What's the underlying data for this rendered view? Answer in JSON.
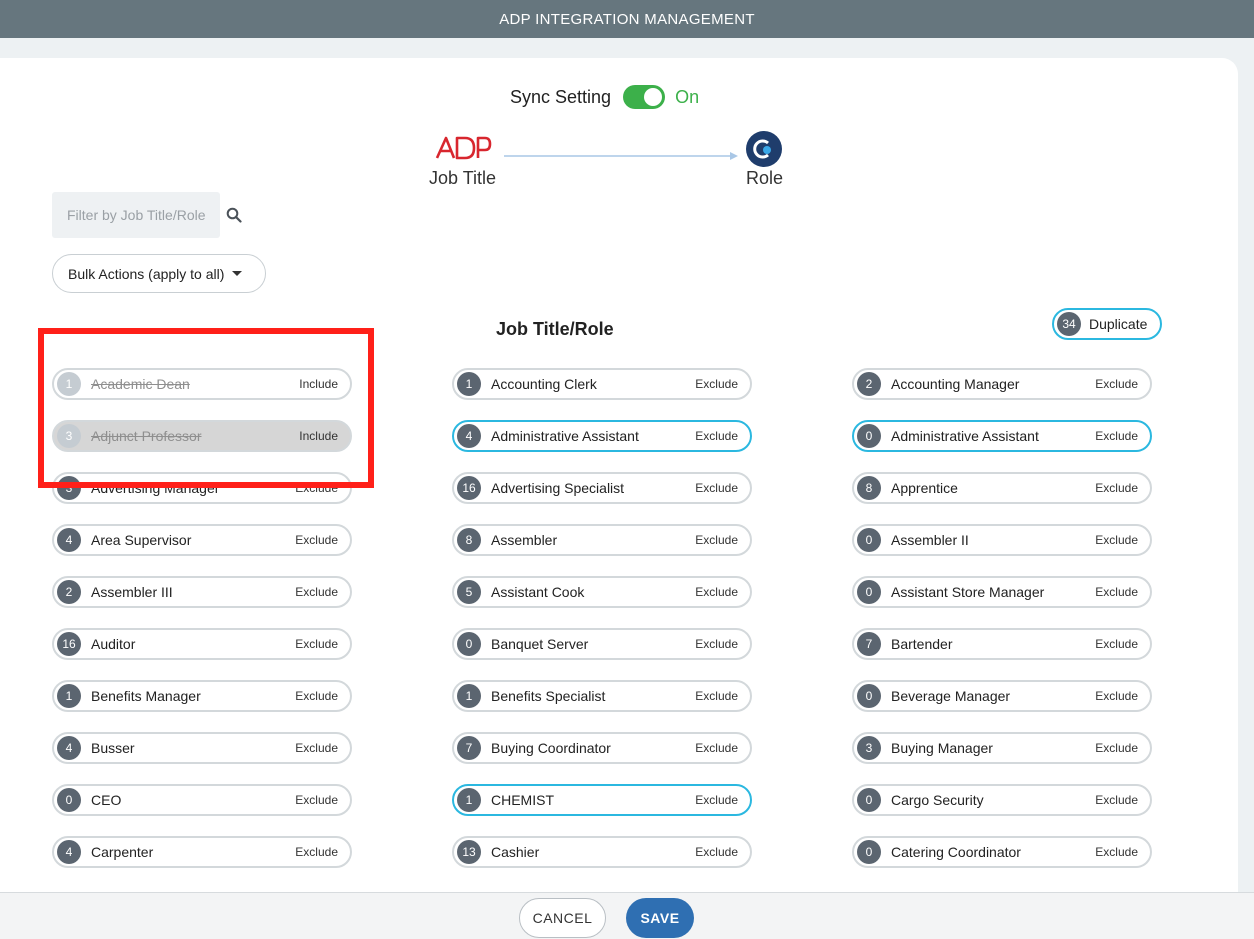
{
  "header": {
    "title": "ADP INTEGRATION MANAGEMENT"
  },
  "sync": {
    "label": "Sync Setting",
    "state": "On",
    "enabled": true,
    "accent": "#3cb04a"
  },
  "mapping": {
    "source_label": "Job Title",
    "target_label": "Role",
    "source_logo_text": "ADP",
    "source_icon": "adp-logo",
    "target_icon": "role-app-logo"
  },
  "filter": {
    "placeholder": "Filter by Job Title/Role",
    "value": "",
    "icon": "search-icon"
  },
  "bulk": {
    "label": "Bulk Actions (apply to all)"
  },
  "section": {
    "title": "Job Title/Role"
  },
  "duplicate": {
    "count": "34",
    "label": "Duplicate",
    "color": "#2bb8e0"
  },
  "items": [
    {
      "count": "1",
      "name": "Academic Dean",
      "action": "Include",
      "included": true
    },
    {
      "count": "1",
      "name": "Accounting Clerk",
      "action": "Exclude"
    },
    {
      "count": "2",
      "name": "Accounting Manager",
      "action": "Exclude"
    },
    {
      "count": "3",
      "name": "Adjunct Professor",
      "action": "Include",
      "included": true,
      "shaded": true
    },
    {
      "count": "4",
      "name": "Administrative Assistant",
      "action": "Exclude",
      "duplicate": true
    },
    {
      "count": "0",
      "name": "Administrative Assistant",
      "action": "Exclude",
      "duplicate": true
    },
    {
      "count": "3",
      "name": "Advertising Manager",
      "action": "Exclude"
    },
    {
      "count": "16",
      "name": "Advertising Specialist",
      "action": "Exclude"
    },
    {
      "count": "8",
      "name": "Apprentice",
      "action": "Exclude"
    },
    {
      "count": "4",
      "name": "Area Supervisor",
      "action": "Exclude"
    },
    {
      "count": "8",
      "name": "Assembler",
      "action": "Exclude"
    },
    {
      "count": "0",
      "name": "Assembler II",
      "action": "Exclude"
    },
    {
      "count": "2",
      "name": "Assembler III",
      "action": "Exclude"
    },
    {
      "count": "5",
      "name": "Assistant Cook",
      "action": "Exclude"
    },
    {
      "count": "0",
      "name": "Assistant Store Manager",
      "action": "Exclude"
    },
    {
      "count": "16",
      "name": "Auditor",
      "action": "Exclude"
    },
    {
      "count": "0",
      "name": "Banquet Server",
      "action": "Exclude"
    },
    {
      "count": "7",
      "name": "Bartender",
      "action": "Exclude"
    },
    {
      "count": "1",
      "name": "Benefits Manager",
      "action": "Exclude"
    },
    {
      "count": "1",
      "name": "Benefits Specialist",
      "action": "Exclude"
    },
    {
      "count": "0",
      "name": "Beverage Manager",
      "action": "Exclude"
    },
    {
      "count": "4",
      "name": "Busser",
      "action": "Exclude"
    },
    {
      "count": "7",
      "name": "Buying Coordinator",
      "action": "Exclude"
    },
    {
      "count": "3",
      "name": "Buying Manager",
      "action": "Exclude"
    },
    {
      "count": "0",
      "name": "CEO",
      "action": "Exclude"
    },
    {
      "count": "1",
      "name": "CHEMIST",
      "action": "Exclude",
      "duplicate": true
    },
    {
      "count": "0",
      "name": "Cargo Security",
      "action": "Exclude"
    },
    {
      "count": "4",
      "name": "Carpenter",
      "action": "Exclude"
    },
    {
      "count": "13",
      "name": "Cashier",
      "action": "Exclude"
    },
    {
      "count": "0",
      "name": "Catering Coordinator",
      "action": "Exclude"
    }
  ],
  "footer": {
    "cancel_label": "CANCEL",
    "save_label": "SAVE"
  },
  "colors": {
    "topbar": "#66767e",
    "save": "#2f6fb2",
    "highlight": "#ff2019"
  }
}
